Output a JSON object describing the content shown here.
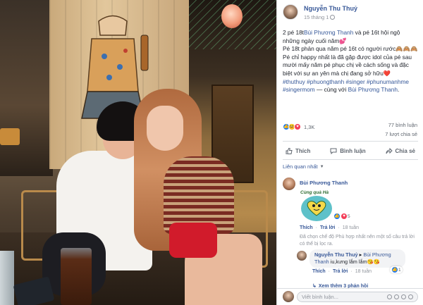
{
  "post": {
    "author": "Nguyễn Thu Thuỷ",
    "time": "15 tháng 1",
    "text_line1": "2 pé 18t",
    "tag1": "Bùi Phương Thanh",
    "text_line1b": " và pé 16t hội ngộ những ngày cuối năm💕",
    "text_line2": "Pé 18t phản qua năm pé 16t có người rước🙈🙈🙈",
    "text_line3": "Pé chỉ happy nhất là đã gặp được idol của pé sau mười mấy năm pé phục chị về cách sống và đặc biệt với sự an yên mà chị đang sở hữu❤️",
    "hashtags": "#thuthuy #phuongthanh #singer #phunumanhme #singermom",
    "with_text": " — cùng với ",
    "tag2": "Bùi Phương Thanh",
    "end": "."
  },
  "reactions": {
    "count": "1,3K",
    "comments": "77 bình luận",
    "shares": "7 lượt chia sẻ",
    "icons": [
      "like-reaction",
      "haha-reaction",
      "love-reaction"
    ]
  },
  "actions": {
    "like": "Thích",
    "comment": "Bình luận",
    "share": "Chia sẻ"
  },
  "comments": {
    "sort_label": "Liên quan nhất",
    "c1": {
      "name": "Bùi Phương Thanh",
      "sticker_text": "Cùng quà Hà",
      "like_count": "5",
      "like_label": "Thích",
      "reply_label": "Trả lời",
      "age": "18 tuần"
    },
    "filter_note": "Đã chọn chế độ Phù hợp nhất nên một số câu trả lời có thể bị lọc ra.",
    "c2": {
      "name": "Nguyễn Thu Thuỷ",
      "tag": "Bùi Phương Thanh",
      "text": " iu,kưng lắm lắm😘😘",
      "like_count": "1",
      "like_label": "Thích",
      "reply_label": "Trả lời",
      "age": "18 tuần"
    },
    "more_replies": "Xem thêm 3 phản hồi",
    "write_placeholder": "Viết bình luận..."
  },
  "colors": {
    "link": "#385898",
    "like_blue": "#1877f2",
    "love_red": "#f33e58",
    "haha_yellow": "#f7b125"
  }
}
